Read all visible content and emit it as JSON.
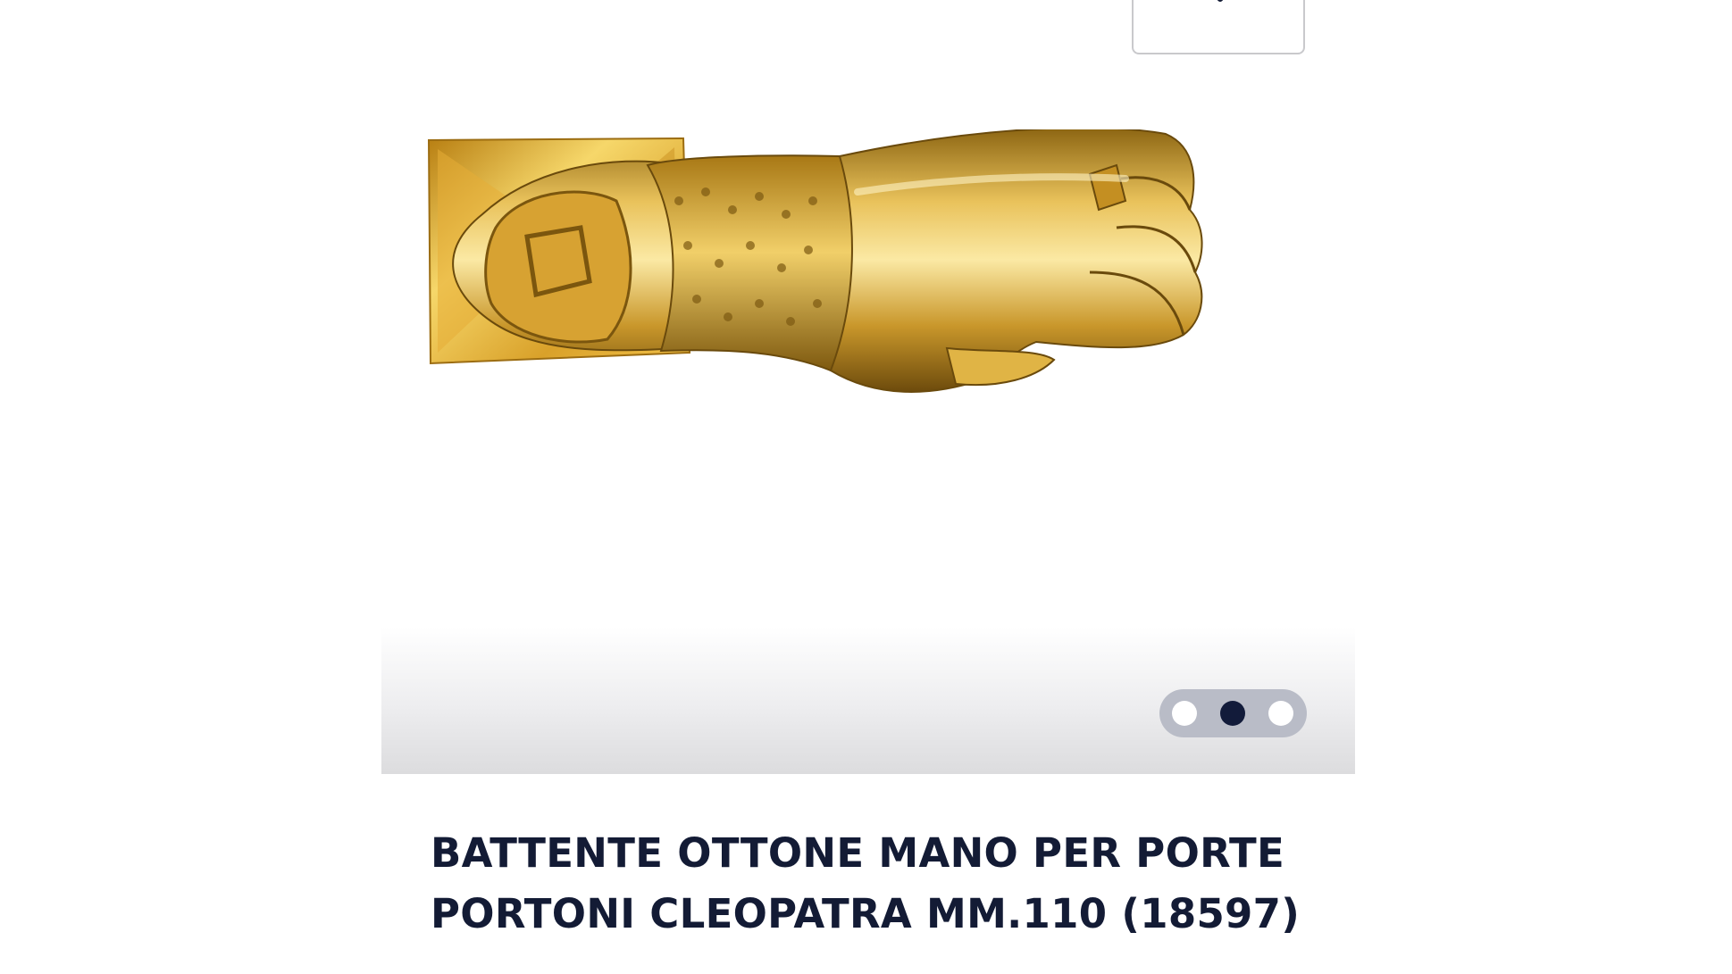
{
  "product": {
    "title_line1": "BATTENTE OTTONE MANO PER PORTE",
    "title_line2": "PORTONI CLEOPATRA MM.110 (18597)"
  },
  "gallery": {
    "slide_count": 3,
    "active_slide": 2
  },
  "icons": {
    "wishlist": "heart-icon"
  },
  "colors": {
    "title": "#131b35",
    "active_dot": "#121b3a",
    "dots_background": "#b9bcc7",
    "brass": "#d9a92b"
  }
}
